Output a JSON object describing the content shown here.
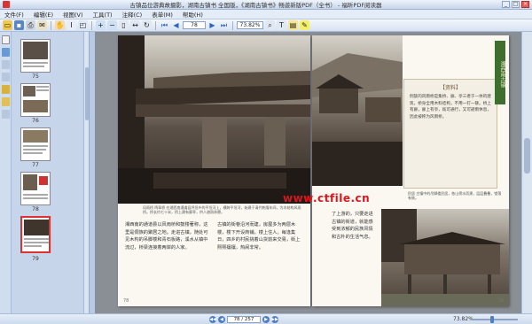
{
  "window": {
    "title": "古镇品位游典故摄影，湖南古镇书 全国版，《湖南古镇书》畅遊新版PDF（全书） - 福昕PDF阅读器",
    "minimize_label": "_",
    "maximize_label": "□",
    "close_label": "×"
  },
  "menu": [
    "文件(F)",
    "编辑(E)",
    "视图(V)",
    "工具(T)",
    "注释(C)",
    "表单(M)",
    "帮助(H)"
  ],
  "toolbar": {
    "icons": [
      "open-icon",
      "save-icon",
      "print-icon",
      "email-icon",
      "hand-icon",
      "select-icon",
      "snapshot-icon",
      "zoom-in-icon",
      "zoom-out-icon",
      "fit-page-icon",
      "fit-width-icon",
      "rotate-icon",
      "first-page-icon",
      "prev-page-icon",
      "next-page-icon",
      "last-page-icon",
      "search-icon",
      "typewriter-icon",
      "note-icon",
      "highlight-icon"
    ],
    "page_value": "78",
    "zoom_value": "73.82%"
  },
  "thumbnails": [
    {
      "label": "75"
    },
    {
      "label": "76"
    },
    {
      "label": "77"
    },
    {
      "label": "78"
    },
    {
      "label": "79"
    }
  ],
  "left_page": {
    "caption": "风雨桥  鸣翠桥  在湘西南通道县坪坦乡的平坦河上，横跨平坦河，始建于清代乾隆年间，为木结构风雨桥。桥长约七十米，桥上建有廊亭，供人避雨休憩。",
    "col1": "湘西南的通道县以风雨桥和鼓楼著称，这里是侗族的聚居之地。走进古镇，随处可见木构的吊脚楼和青石板路，溪水从镇中流过，桥梁连接着两岸的人家。",
    "col2": "古镇的街巷沿河而建，房屋多为两层木楼，楼下开设商铺，楼上住人。每逢集日，四乡的村民挑着山货前来交易，街上熙熙攘攘，热闹非常。",
    "page_number": "78"
  },
  "right_page": {
    "banner": "湘西南古镇",
    "box_title": "【资料】",
    "box_body": "侗族的风雨桥是集桥、廊、亭三者于一体的建筑，桥身全用木料结构，不用一钉一铆。桥上有廊，廊上有亭，既可通行，又可避雨休息，因此被称为风雨桥。",
    "caption": "民居  古镇中的吊脚楼民居，依山傍水而建，层层叠叠，错落有致。",
    "col_text": "了上游的，只要走进古镇的街道，就能感受到浓郁的民族风情和古朴的生活气息。",
    "page_number": "79"
  },
  "watermark": "www.ctfile.cn",
  "statusbar": {
    "first_label": "◀◀",
    "prev_label": "◀",
    "page_display": "78 / 257",
    "next_label": "▶",
    "last_label": "▶▶",
    "zoom_display": "73.82%"
  }
}
